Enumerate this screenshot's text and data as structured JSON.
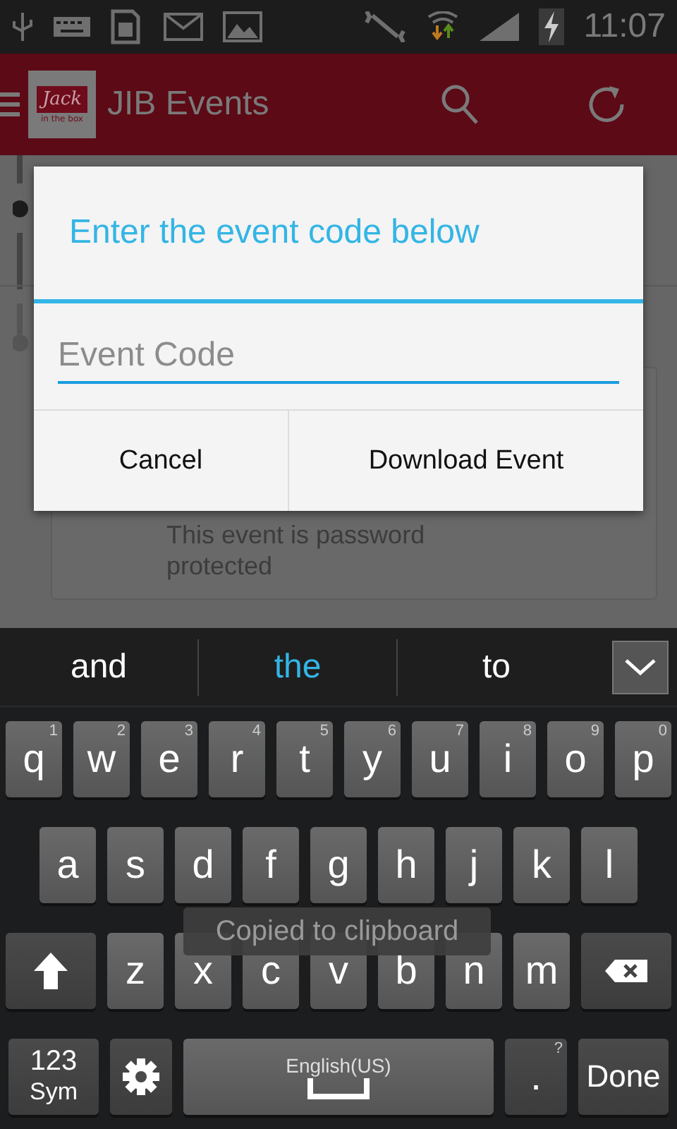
{
  "status_bar": {
    "time": "11:07"
  },
  "app_bar": {
    "logo": {
      "top": "Jack",
      "bottom": "in the box"
    },
    "title": "JIB Events"
  },
  "background": {
    "card_text": "This event is password protected"
  },
  "dialog": {
    "title": "Enter the event code below",
    "field": {
      "placeholder": "Event Code"
    },
    "buttons": [
      "Cancel",
      "Download Event"
    ]
  },
  "keyboard": {
    "suggestions": [
      {
        "text": "and",
        "selected": false
      },
      {
        "text": "the",
        "selected": true
      },
      {
        "text": "to",
        "selected": false
      }
    ],
    "key_rows": [
      {
        "keys": [
          {
            "kind": "letter",
            "label": "q",
            "hint": "1"
          },
          {
            "kind": "letter",
            "label": "w",
            "hint": "2"
          },
          {
            "kind": "letter",
            "label": "e",
            "hint": "3"
          },
          {
            "kind": "letter",
            "label": "r",
            "hint": "4"
          },
          {
            "kind": "letter",
            "label": "t",
            "hint": "5"
          },
          {
            "kind": "letter",
            "label": "y",
            "hint": "6"
          },
          {
            "kind": "letter",
            "label": "u",
            "hint": "7"
          },
          {
            "kind": "letter",
            "label": "i",
            "hint": "8"
          },
          {
            "kind": "letter",
            "label": "o",
            "hint": "9"
          },
          {
            "kind": "letter",
            "label": "p",
            "hint": "0"
          }
        ]
      },
      {
        "keys": [
          {
            "kind": "letter",
            "label": "a"
          },
          {
            "kind": "letter",
            "label": "s"
          },
          {
            "kind": "letter",
            "label": "d"
          },
          {
            "kind": "letter",
            "label": "f"
          },
          {
            "kind": "letter",
            "label": "g"
          },
          {
            "kind": "letter",
            "label": "h"
          },
          {
            "kind": "letter",
            "label": "j"
          },
          {
            "kind": "letter",
            "label": "k"
          },
          {
            "kind": "letter",
            "label": "l"
          }
        ]
      },
      {
        "keys": [
          {
            "kind": "shift"
          },
          {
            "kind": "letter",
            "label": "z"
          },
          {
            "kind": "letter",
            "label": "x"
          },
          {
            "kind": "letter",
            "label": "c"
          },
          {
            "kind": "letter",
            "label": "v"
          },
          {
            "kind": "letter",
            "label": "b"
          },
          {
            "kind": "letter",
            "label": "n"
          },
          {
            "kind": "letter",
            "label": "m"
          },
          {
            "kind": "backspace"
          }
        ]
      },
      {
        "keys": [
          {
            "kind": "sym",
            "label": "123",
            "sublabel": "Sym"
          },
          {
            "kind": "settings"
          },
          {
            "kind": "space",
            "label": "English(US)"
          },
          {
            "kind": "period",
            "label": ".",
            "hint": "?"
          },
          {
            "kind": "done",
            "label": "Done"
          }
        ]
      }
    ]
  },
  "toast": "Copied to clipboard"
}
